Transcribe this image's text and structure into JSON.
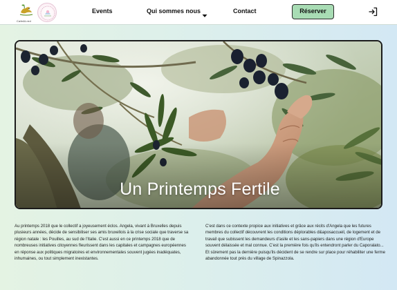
{
  "brand": {
    "logo_text": "Cafe&Lred",
    "logo_icon": "bird-logo-icon",
    "partner_logo_icon": "partner-seal-icon"
  },
  "nav": {
    "events": "Events",
    "about": "Qui sommes nous",
    "about_icon": "chevron-down-icon",
    "contact": "Contact",
    "reserve": "Réserver",
    "login_icon": "login-icon"
  },
  "colors": {
    "accent": "#a8dcb4",
    "background_left": "#e4f3e3",
    "background_right": "#d3e8f4"
  },
  "hero": {
    "title": "Un Printemps Fertile"
  },
  "article": {
    "left": "Au printemps 2018 que le collectif a joyeusement éclos. Angela, vivant à Bruxelles depuis plusieurs années, décide de sensibiliser ses amis bruxellois à la crise sociale que traverse sa région natale : les Pouilles, au sud de l'Italie. C'est aussi en ce printemps 2018 que de nombreuses initiatives citoyennes fleurissent dans les capitales et campagnes européennes en réponse aux politiques migratoires et environnementales souvent jugées inadéquates, inhumaines, ou tout simplement inexistantes.",
    "right": "C'est dans ce contexte propice aux initiatives et grâce aux récits d'Angela que les futures membres du collectif découvrent les conditions déplorables d&aposaccueil, de logement et de travail que subissent les demandeurs d'asile et les sans-papiers dans une région d'Europe souvent délaissée et mal connue. C'est la première fois qu'ils entendront parler du Caporalato... Et sûrement pas la dernière puisqu'ils décident de se rendre sur place pour réhabiliter une ferme abandonnée tout près du village de Spinazzola."
  }
}
